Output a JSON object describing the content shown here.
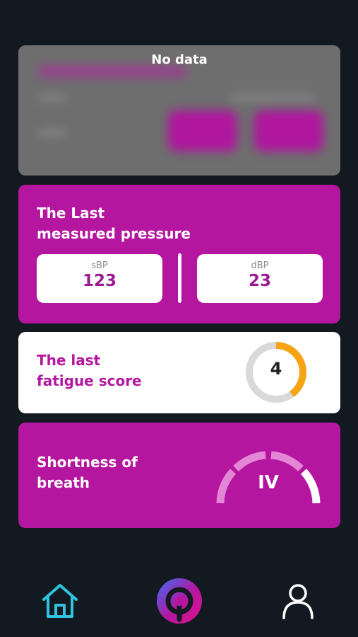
{
  "no_data_card": {
    "title": "No data"
  },
  "pressure_card": {
    "title_line1": "The Last",
    "title_line2": "measured pressure",
    "sbp_label": "sBP",
    "sbp_value": "123",
    "dbp_label": "dBP",
    "dbp_value": "23"
  },
  "fatigue_card": {
    "title_line1": "The last",
    "title_line2": "fatigue score",
    "score": "4",
    "score_fraction": 0.4,
    "ring_color": "#f7a414"
  },
  "breath_card": {
    "title_line1": "Shortness of",
    "title_line2": "breath",
    "level": "IV"
  },
  "nav": {
    "items": [
      "home-icon",
      "app-logo-icon",
      "profile-icon"
    ],
    "active_color": "#2ec4e0"
  },
  "colors": {
    "background": "#121920",
    "magenta": "#b5169f",
    "value_purple": "#9c1a8f"
  }
}
